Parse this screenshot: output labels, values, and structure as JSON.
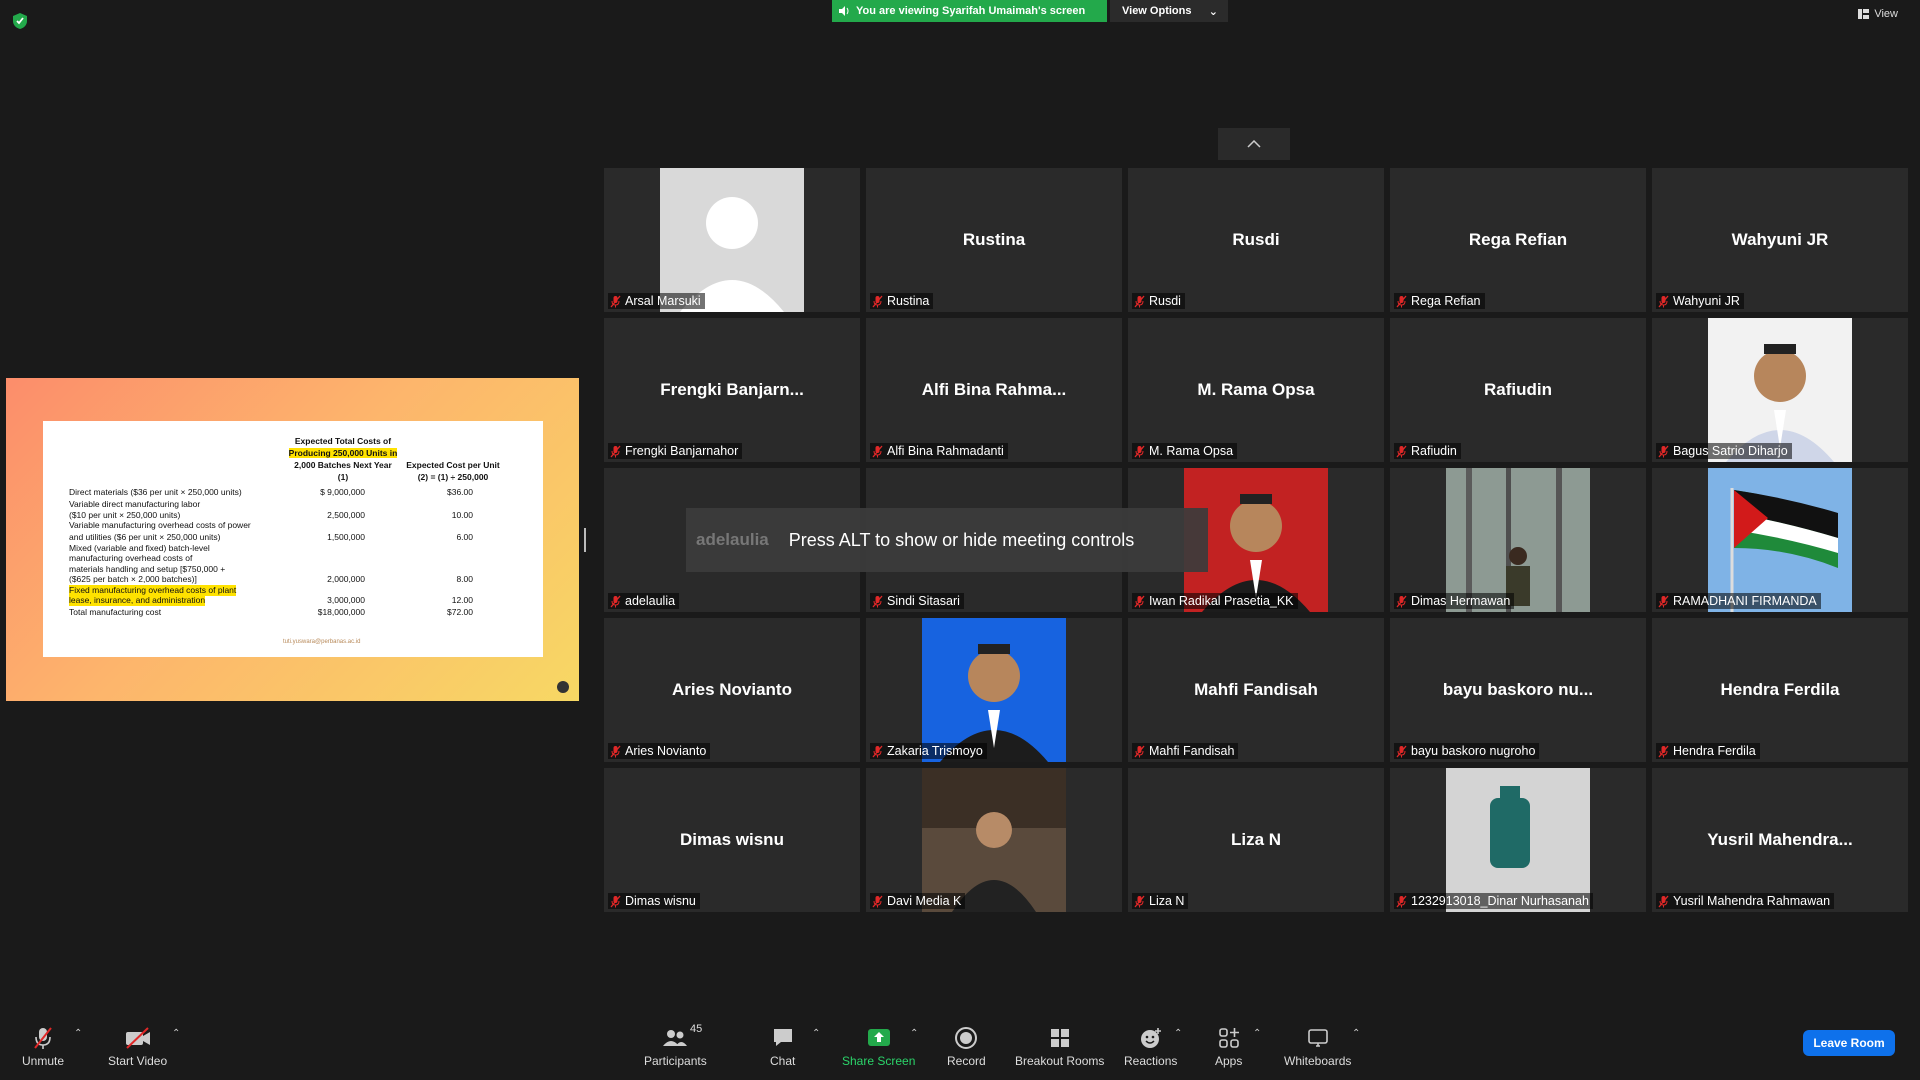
{
  "banner": {
    "viewing_text": "You are viewing Syarifah Umaimah's screen",
    "view_options": "View Options",
    "view": "View"
  },
  "slide": {
    "head1": [
      "Expected Total Costs of",
      "Producing 250,000 Units in",
      "2,000 Batches Next Year",
      "(1)"
    ],
    "head2": [
      "Expected Cost per Unit",
      "(2) = (1) ÷ 250,000"
    ],
    "rows": [
      {
        "label": "Direct materials ($36 per unit × 250,000 units)",
        "v1": "$ 9,000,000",
        "v2": "$36.00"
      },
      {
        "label": "Variable direct manufacturing labor",
        "v1": "",
        "v2": ""
      },
      {
        "label": "   ($10 per unit × 250,000 units)",
        "v1": "2,500,000",
        "v2": "10.00"
      },
      {
        "label": "Variable manufacturing overhead costs of power",
        "v1": "",
        "v2": ""
      },
      {
        "label": "   and utilities ($6 per unit × 250,000 units)",
        "v1": "1,500,000",
        "v2": "6.00"
      },
      {
        "label": "Mixed (variable and fixed) batch-level",
        "v1": "",
        "v2": ""
      },
      {
        "label": "   manufacturing overhead costs of",
        "v1": "",
        "v2": ""
      },
      {
        "label": "   materials handling and setup [$750,000 +",
        "v1": "",
        "v2": ""
      },
      {
        "label": "   ($625 per batch × 2,000 batches)]",
        "v1": "2,000,000",
        "v2": "8.00"
      },
      {
        "label": "Fixed manufacturing overhead costs of plant",
        "v1": "",
        "v2": ""
      },
      {
        "label": "   lease, insurance, and administration",
        "v1": "3,000,000",
        "v2": "12.00"
      },
      {
        "label": "Total manufacturing cost",
        "v1": "$18,000,000",
        "v2": "$72.00"
      }
    ],
    "footer": "tuti.yuswara@perbanas.ac.id"
  },
  "toast": {
    "who": "adelaulia",
    "message": "Press ALT to show or hide meeting controls"
  },
  "participants": [
    {
      "big": "",
      "tag": "Arsal Marsuki",
      "photo": "avatar"
    },
    {
      "big": "Rustina",
      "tag": "Rustina"
    },
    {
      "big": "Rusdi",
      "tag": "Rusdi"
    },
    {
      "big": "Rega Refian",
      "tag": "Rega Refian"
    },
    {
      "big": "Wahyuni JR",
      "tag": "Wahyuni JR"
    },
    {
      "big": "Frengki  Banjarn...",
      "tag": "Frengki Banjarnahor"
    },
    {
      "big": "Alfi  Bina  Rahma...",
      "tag": "Alfi Bina Rahmadanti"
    },
    {
      "big": "M. Rama Opsa",
      "tag": "M. Rama Opsa"
    },
    {
      "big": "Rafiudin",
      "tag": "Rafiudin"
    },
    {
      "big": "",
      "tag": "Bagus Satrio Diharjo",
      "photo": "man-white"
    },
    {
      "big": "",
      "tag": "adelaulia"
    },
    {
      "big": "",
      "tag": "Sindi Sitasari"
    },
    {
      "big": "",
      "tag": "Iwan Radikal Prasetia_KK",
      "photo": "man-red"
    },
    {
      "big": "",
      "tag": "Dimas Hermawan",
      "photo": "forest"
    },
    {
      "big": "",
      "tag": "RAMADHANI FIRMANDA",
      "photo": "flag"
    },
    {
      "big": "Aries Novianto",
      "tag": "Aries Novianto"
    },
    {
      "big": "",
      "tag": "Zakaria Trismoyo",
      "photo": "man-blue"
    },
    {
      "big": "Mahfi Fandisah",
      "tag": "Mahfi Fandisah"
    },
    {
      "big": "bayu baskoro nu...",
      "tag": "bayu baskoro nugroho"
    },
    {
      "big": "Hendra Ferdila",
      "tag": "Hendra Ferdila"
    },
    {
      "big": "Dimas wisnu",
      "tag": "Dimas wisnu"
    },
    {
      "big": "",
      "tag": "Davi Media K",
      "photo": "cafe"
    },
    {
      "big": "Liza N",
      "tag": "Liza N"
    },
    {
      "big": "",
      "tag": "1232913018_Dinar Nurhasanah",
      "photo": "bottle"
    },
    {
      "big": "Yusril  Mahendra...",
      "tag": "Yusril Mahendra Rahmawan"
    }
  ],
  "toolbar": {
    "unmute": "Unmute",
    "start_video": "Start Video",
    "participants": "Participants",
    "participants_count": "45",
    "chat": "Chat",
    "share_screen": "Share Screen",
    "record": "Record",
    "breakout": "Breakout Rooms",
    "reactions": "Reactions",
    "apps": "Apps",
    "whiteboards": "Whiteboards",
    "leave": "Leave Room"
  }
}
